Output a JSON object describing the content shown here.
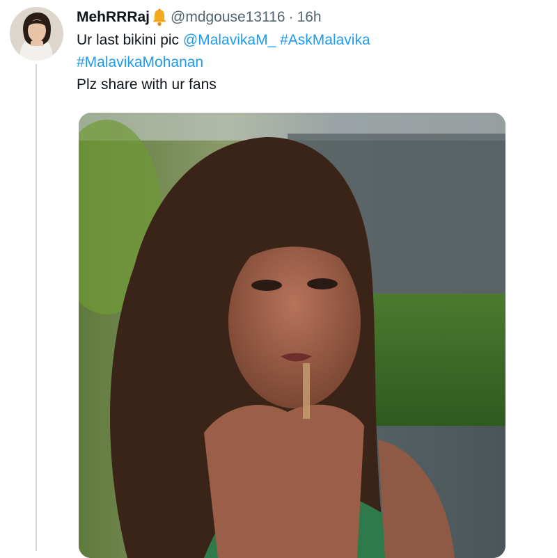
{
  "tweet": {
    "display_name": "MehRRRaj",
    "verified_emoji": "bell-icon",
    "handle": "@mdgouse13116",
    "separator": "·",
    "time": "16h",
    "text": {
      "prefix": "Ur last bikini pic",
      "mention": "@MalavikaM_",
      "hashtag1": "#AskMalavika",
      "hashtag2": "#MalavikaMohanan",
      "line3": "Plz share with ur fans"
    },
    "media": {
      "type": "photo",
      "icon": "photo-icon"
    }
  },
  "colors": {
    "link": "#1d9bf0",
    "text": "#0f1419",
    "secondary": "#536471",
    "thread_line": "#cfd9de"
  }
}
